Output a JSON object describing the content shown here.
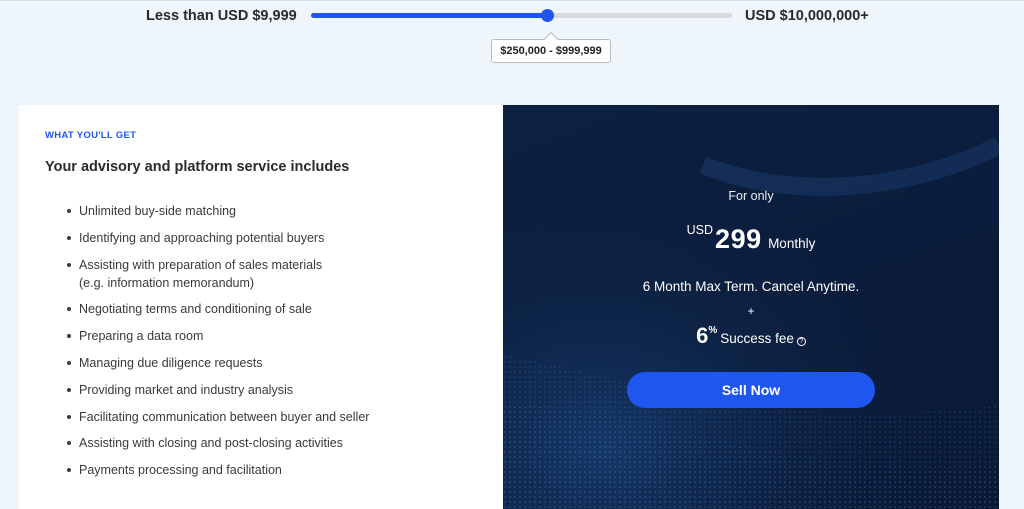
{
  "slider": {
    "min_label": "Less than USD $9,999",
    "max_label": "USD $10,000,000+",
    "selected_range": "$250,000 - $999,999",
    "position_fraction": 0.56
  },
  "features": {
    "eyebrow": "WHAT YOU'LL GET",
    "title": "Your advisory and platform service includes",
    "items": [
      "Unlimited buy-side matching",
      "Identifying and approaching potential buyers",
      "Assisting with preparation of sales materials",
      "(e.g. information memorandum)",
      "Negotiating terms and conditioning of sale",
      "Preparing a data room",
      "Managing due diligence requests",
      "Providing market and industry analysis",
      "Facilitating communication between buyer and seller",
      "Assisting with closing and post-closing activities",
      "Payments processing and facilitation"
    ]
  },
  "pricing": {
    "for_only": "For only",
    "currency": "USD",
    "amount": "299",
    "period": "Monthly",
    "term": "6 Month Max Term. Cancel Anytime.",
    "plus": "+",
    "fee_value": "6",
    "fee_unit": "%",
    "fee_label": "Success fee",
    "help_glyph": "?",
    "cta_label": "Sell Now"
  },
  "colors": {
    "accent": "#1f56f0",
    "dark_panel": "#0b1d3c",
    "page_bg": "#eef5fb"
  }
}
